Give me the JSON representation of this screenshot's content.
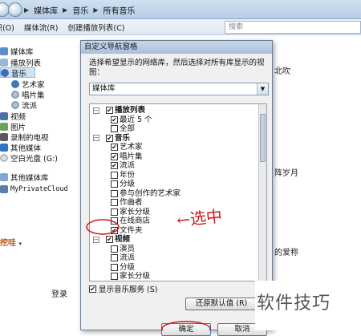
{
  "window": {
    "breadcrumb": [
      "媒体库",
      "音乐",
      "所有音乐"
    ],
    "toolbar": [
      "组织(O)",
      "媒体流(R)",
      "创建播放列表(C)"
    ],
    "search_placeholder": "搜索"
  },
  "sidebar": {
    "items": [
      {
        "label": "媒体库",
        "icon": "library-icon"
      },
      {
        "label": "播放列表",
        "icon": "playlist-icon"
      },
      {
        "label": "音乐",
        "icon": "music-note-icon",
        "selected": true
      },
      {
        "label": "艺术家",
        "icon": "artist-icon"
      },
      {
        "label": "唱片集",
        "icon": "album-icon"
      },
      {
        "label": "流派",
        "icon": "genre-icon"
      },
      {
        "label": "视频",
        "icon": "video-icon"
      },
      {
        "label": "图片",
        "icon": "picture-icon"
      },
      {
        "label": "录制的电视",
        "icon": "recorded-tv-icon"
      },
      {
        "label": "其他媒体",
        "icon": "other-media-icon"
      },
      {
        "label": "空白光盘 (G:)",
        "icon": "blank-disc-icon"
      },
      {
        "label": "其他媒体库",
        "icon": "other-library-icon"
      },
      {
        "label": "MyPrivateCloud",
        "icon": "computer-icon"
      }
    ],
    "wa_link": "挖哇",
    "login": "登录"
  },
  "background_text": [
    "北吹",
    "阵岁月",
    "的爱称"
  ],
  "dialog": {
    "title": "自定义导航窗格",
    "prompt": "选择希望显示的网络库，然后选择对所有库显示的视图：",
    "selected_library": "媒体库",
    "tree": [
      {
        "label": "播放列表",
        "level": 0,
        "checked": true,
        "bold": true,
        "expander": "−"
      },
      {
        "label": "最近 5 个",
        "level": 1,
        "checked": true
      },
      {
        "label": "全部",
        "level": 1,
        "checked": false
      },
      {
        "label": "音乐",
        "level": 0,
        "checked": true,
        "bold": true,
        "expander": "−"
      },
      {
        "label": "艺术家",
        "level": 1,
        "checked": true
      },
      {
        "label": "唱片集",
        "level": 1,
        "checked": true
      },
      {
        "label": "流派",
        "level": 1,
        "checked": true
      },
      {
        "label": "年份",
        "level": 1,
        "checked": false
      },
      {
        "label": "分级",
        "level": 1,
        "checked": false
      },
      {
        "label": "参与创作的艺术家",
        "level": 1,
        "checked": false
      },
      {
        "label": "作曲者",
        "level": 1,
        "checked": false
      },
      {
        "label": "家长分级",
        "level": 1,
        "checked": false
      },
      {
        "label": "在线商店",
        "level": 1,
        "checked": false
      },
      {
        "label": "文件夹",
        "level": 1,
        "checked": true
      },
      {
        "label": "视频",
        "level": 0,
        "checked": true,
        "bold": true,
        "expander": "−"
      },
      {
        "label": "演员",
        "level": 1,
        "checked": false
      },
      {
        "label": "流派",
        "level": 1,
        "checked": false
      },
      {
        "label": "分级",
        "level": 1,
        "checked": false
      },
      {
        "label": "家长分级",
        "level": 1,
        "checked": false
      }
    ],
    "show_service_label": "显示音乐服务 (S)",
    "show_service_checked": true,
    "restore_label": "还原默认值 (R)",
    "ok_label": "确定",
    "cancel_label": "取消"
  },
  "annotation": "←选中",
  "watermark": "软件技巧",
  "colors": {
    "annotation_red": "#d01818",
    "selection_blue": "#cde4f7",
    "chrome_blue": "#b6cde6"
  }
}
